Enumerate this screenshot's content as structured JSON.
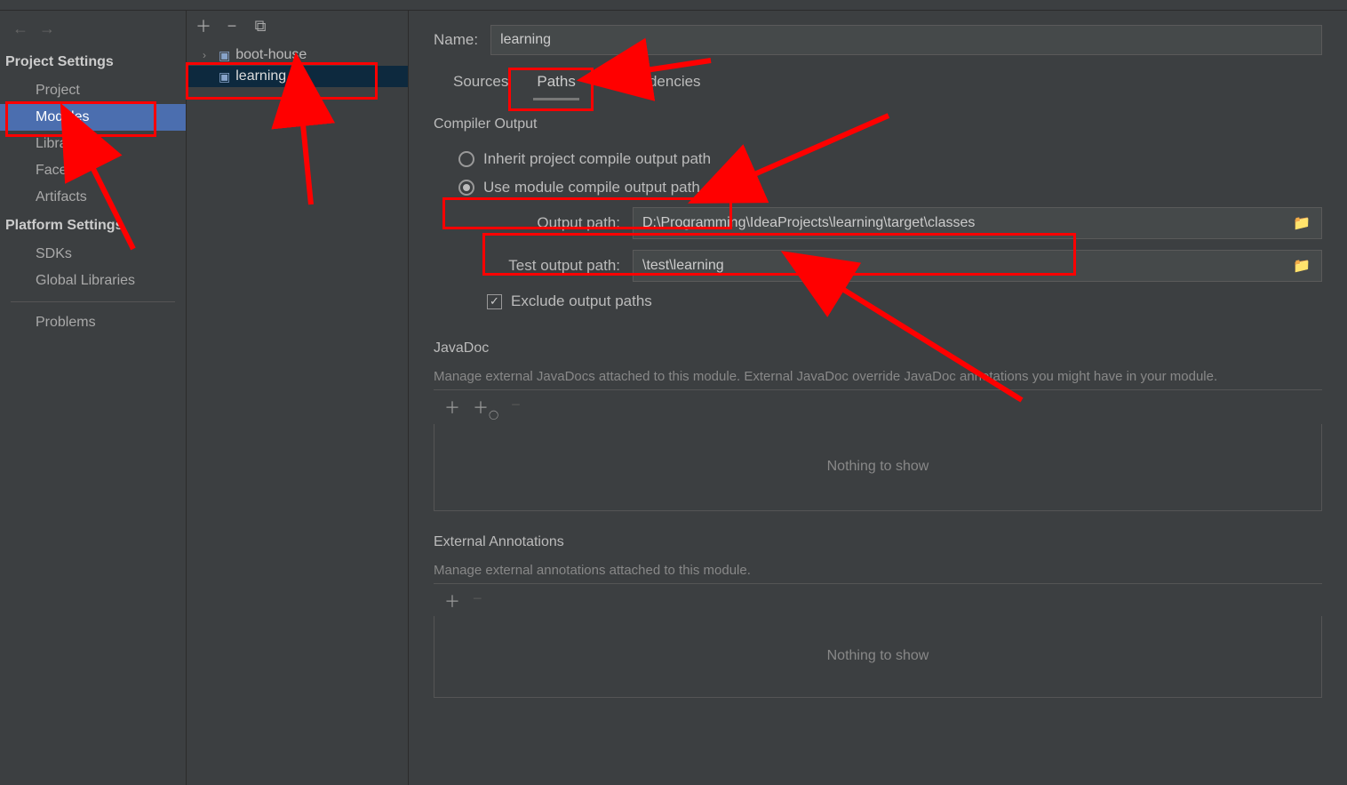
{
  "sidebar": {
    "headingA": "Project Settings",
    "itemsA": [
      "Project",
      "Modules",
      "Libraries",
      "Facets",
      "Artifacts"
    ],
    "headingB": "Platform Settings",
    "itemsB": [
      "SDKs",
      "Global Libraries"
    ],
    "itemsC": [
      "Problems"
    ]
  },
  "tree": {
    "items": [
      {
        "label": "boot-house",
        "expandable": true
      },
      {
        "label": "learning",
        "expandable": false,
        "selected": true
      }
    ]
  },
  "form": {
    "nameLabel": "Name:",
    "nameValue": "learning"
  },
  "tabs": {
    "sources": "Sources",
    "paths": "Paths",
    "deps": "Dependencies"
  },
  "compiler": {
    "title": "Compiler Output",
    "inheritLabel": "Inherit project compile output path",
    "useModuleLabel": "Use module compile output path",
    "outputLabel": "Output path:",
    "outputValue": "D:\\Programming\\IdeaProjects\\learning\\target\\classes",
    "testLabel": "Test output path:",
    "testValue": "\\test\\learning",
    "excludeLabel": "Exclude output paths"
  },
  "javadoc": {
    "title": "JavaDoc",
    "desc": "Manage external JavaDocs attached to this module. External JavaDoc override JavaDoc annotations you might have in your module.",
    "empty": "Nothing to show"
  },
  "annotations": {
    "title": "External Annotations",
    "desc": "Manage external annotations attached to this module.",
    "empty": "Nothing to show"
  }
}
